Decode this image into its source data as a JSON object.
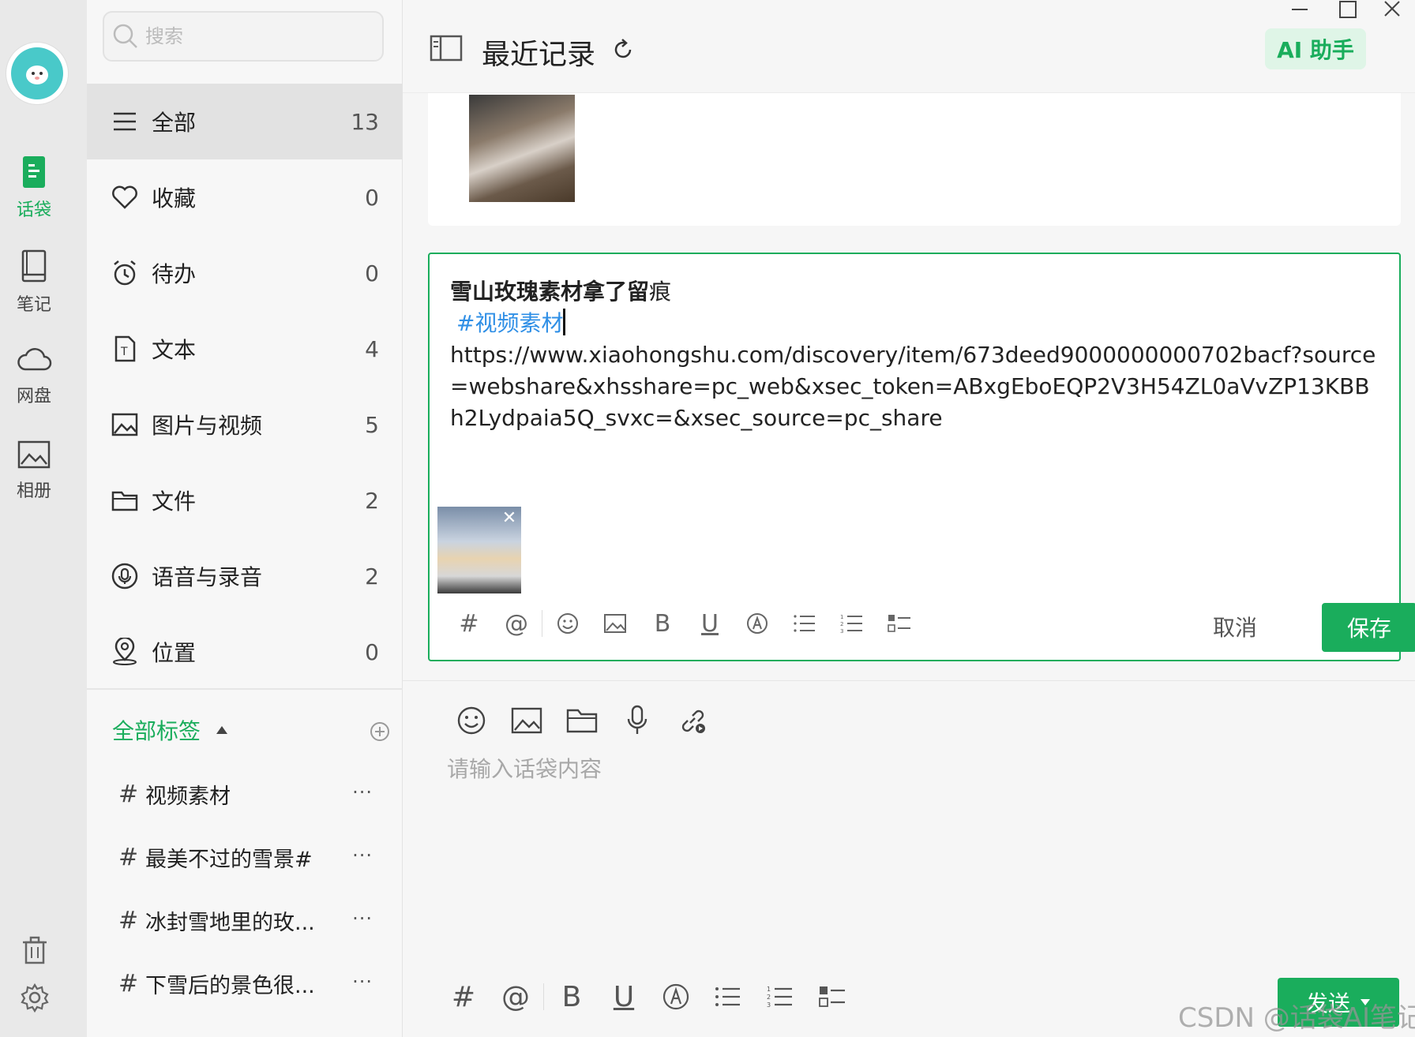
{
  "search": {
    "placeholder": "搜索"
  },
  "rail": {
    "items": [
      {
        "label": "话袋",
        "icon": "note-bag-icon",
        "active": true
      },
      {
        "label": "笔记",
        "icon": "notebook-icon",
        "active": false
      },
      {
        "label": "网盘",
        "icon": "cloud-icon",
        "active": false
      },
      {
        "label": "相册",
        "icon": "album-icon",
        "active": false
      }
    ],
    "bottom": [
      "trash-icon",
      "settings-icon"
    ]
  },
  "categories": [
    {
      "label": "全部",
      "count": "13",
      "icon": "menu-icon",
      "active": true
    },
    {
      "label": "收藏",
      "count": "0",
      "icon": "heart-icon"
    },
    {
      "label": "待办",
      "count": "0",
      "icon": "alarm-clock-icon"
    },
    {
      "label": "文本",
      "count": "4",
      "icon": "text-file-icon"
    },
    {
      "label": "图片与视频",
      "count": "5",
      "icon": "image-icon"
    },
    {
      "label": "文件",
      "count": "2",
      "icon": "folder-icon"
    },
    {
      "label": "语音与录音",
      "count": "2",
      "icon": "microphone-icon"
    },
    {
      "label": "位置",
      "count": "0",
      "icon": "location-icon"
    }
  ],
  "tags": {
    "header": "全部标签",
    "items": [
      {
        "hash": "#",
        "label": "视频素材"
      },
      {
        "hash": "#",
        "label": "最美不过的雪景#"
      },
      {
        "hash": "#",
        "label": "冰封雪地里的玫..."
      },
      {
        "hash": "#",
        "label": "下雪后的景色很..."
      }
    ],
    "more": "···"
  },
  "header": {
    "title": "最近记录",
    "ai_button": "AI 助手"
  },
  "editor": {
    "title_bold": "雪山玫瑰素材拿了留",
    "title_tail": "痕",
    "tag": "#视频素材",
    "url": "https://www.xiaohongshu.com/discovery/item/673deed9000000000702bacf?source=webshare&xhsshare=pc_web&xsec_token=ABxgEboEQP2V3H54ZL0aVvZP13KBBh2Lydpaia5Q_svxc=&xsec_source=pc_share",
    "hash_tool": "#",
    "at_tool": "@",
    "bold_tool": "B",
    "underline_tool": "U",
    "cancel": "取消",
    "save": "保存"
  },
  "compose": {
    "placeholder": "请输入话袋内容",
    "hash_tool": "#",
    "at_tool": "@",
    "bold_tool": "B",
    "underline_tool": "U",
    "send": "发送"
  },
  "watermark": "CSDN @话袋AI笔记",
  "colors": {
    "accent": "#1aad5c",
    "tag_blue": "#2f8fe6",
    "ai_bg": "#dff5e7"
  }
}
